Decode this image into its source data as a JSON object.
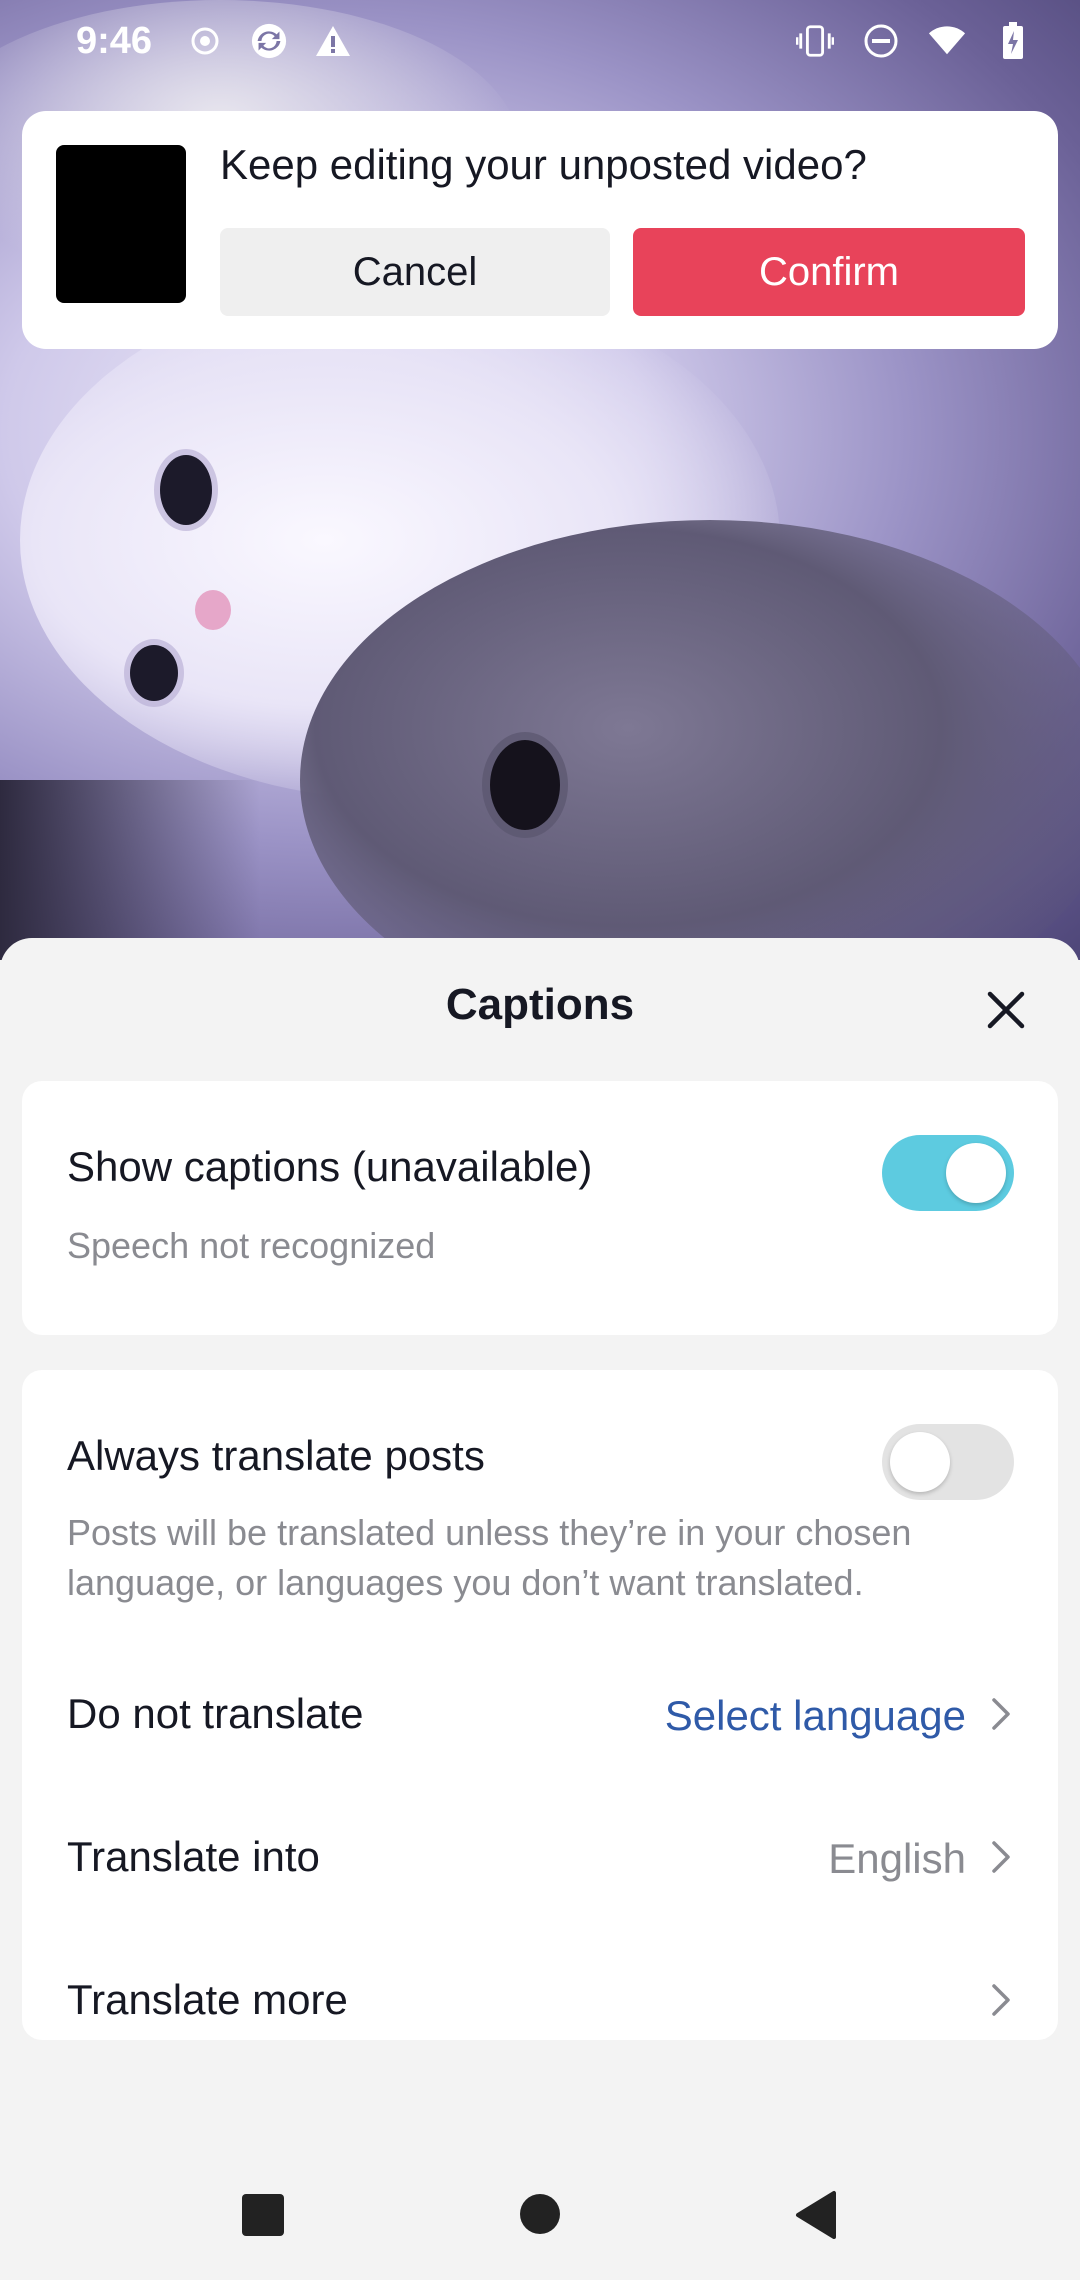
{
  "status_bar": {
    "time": "9:46",
    "left_icons": [
      "record-icon",
      "sync-icon",
      "warning-icon"
    ],
    "right_icons": [
      "vibrate-icon",
      "do-not-disturb-icon",
      "wifi-icon",
      "battery-charging-icon"
    ]
  },
  "draft_dialog": {
    "title": "Keep editing your unposted video?",
    "cancel_label": "Cancel",
    "confirm_label": "Confirm",
    "confirm_color": "#e8435a"
  },
  "captions_sheet": {
    "title": "Captions",
    "show_captions": {
      "label": "Show captions (unavailable)",
      "subtitle": "Speech not recognized",
      "enabled": true
    },
    "always_translate": {
      "label": "Always translate posts",
      "description_line1": "Posts will be translated unless they’re in your chosen",
      "description_line2": "language, or languages you don’t want translated.",
      "enabled": false
    },
    "rows": [
      {
        "label": "Do not translate",
        "value": "Select language",
        "value_color": "#2f5aa8"
      },
      {
        "label": "Translate into",
        "value": "English",
        "value_color": "#8a8b91"
      },
      {
        "label": "Translate more",
        "value": ""
      }
    ],
    "toggle_on_color": "#5dcbe0"
  },
  "nav_bar": {
    "buttons": [
      "recents-button",
      "home-button",
      "back-button"
    ]
  }
}
